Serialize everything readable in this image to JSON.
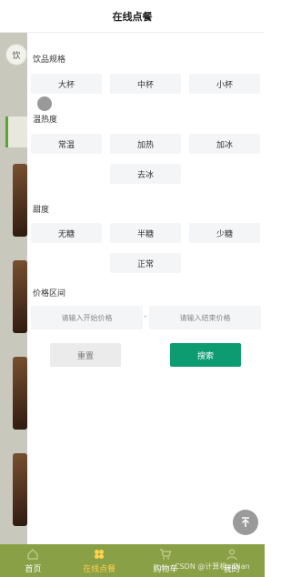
{
  "header": {
    "title": "在线点餐"
  },
  "background": {
    "search_hint": "饮"
  },
  "filter": {
    "sections": {
      "spec": {
        "label": "饮品规格",
        "options": [
          "大杯",
          "中杯",
          "小杯"
        ]
      },
      "temperature": {
        "label": "温热度",
        "options": [
          "常温",
          "加热",
          "加冰",
          "去冰"
        ]
      },
      "sweetness": {
        "label": "甜度",
        "options": [
          "无糖",
          "半糖",
          "少糖",
          "正常"
        ]
      }
    },
    "price": {
      "label": "价格区间",
      "min_placeholder": "请输入开始价格",
      "max_placeholder": "请输入结束价格",
      "separator": "-"
    },
    "reset_label": "重置",
    "search_label": "搜索"
  },
  "tabbar": {
    "items": [
      {
        "label": "首页",
        "icon": "home-icon",
        "active": false
      },
      {
        "label": "在线点餐",
        "icon": "order-icon",
        "active": true
      },
      {
        "label": "购物车",
        "icon": "cart-icon",
        "active": false
      },
      {
        "label": "我的",
        "icon": "user-icon",
        "active": false
      }
    ]
  },
  "watermark": "CSDN @计算机xiDian",
  "colors": {
    "accent": "#0d9c72",
    "tabbar": "#8aa046",
    "tab_active": "#ffd34d",
    "option_bg": "#f4f5f7"
  }
}
